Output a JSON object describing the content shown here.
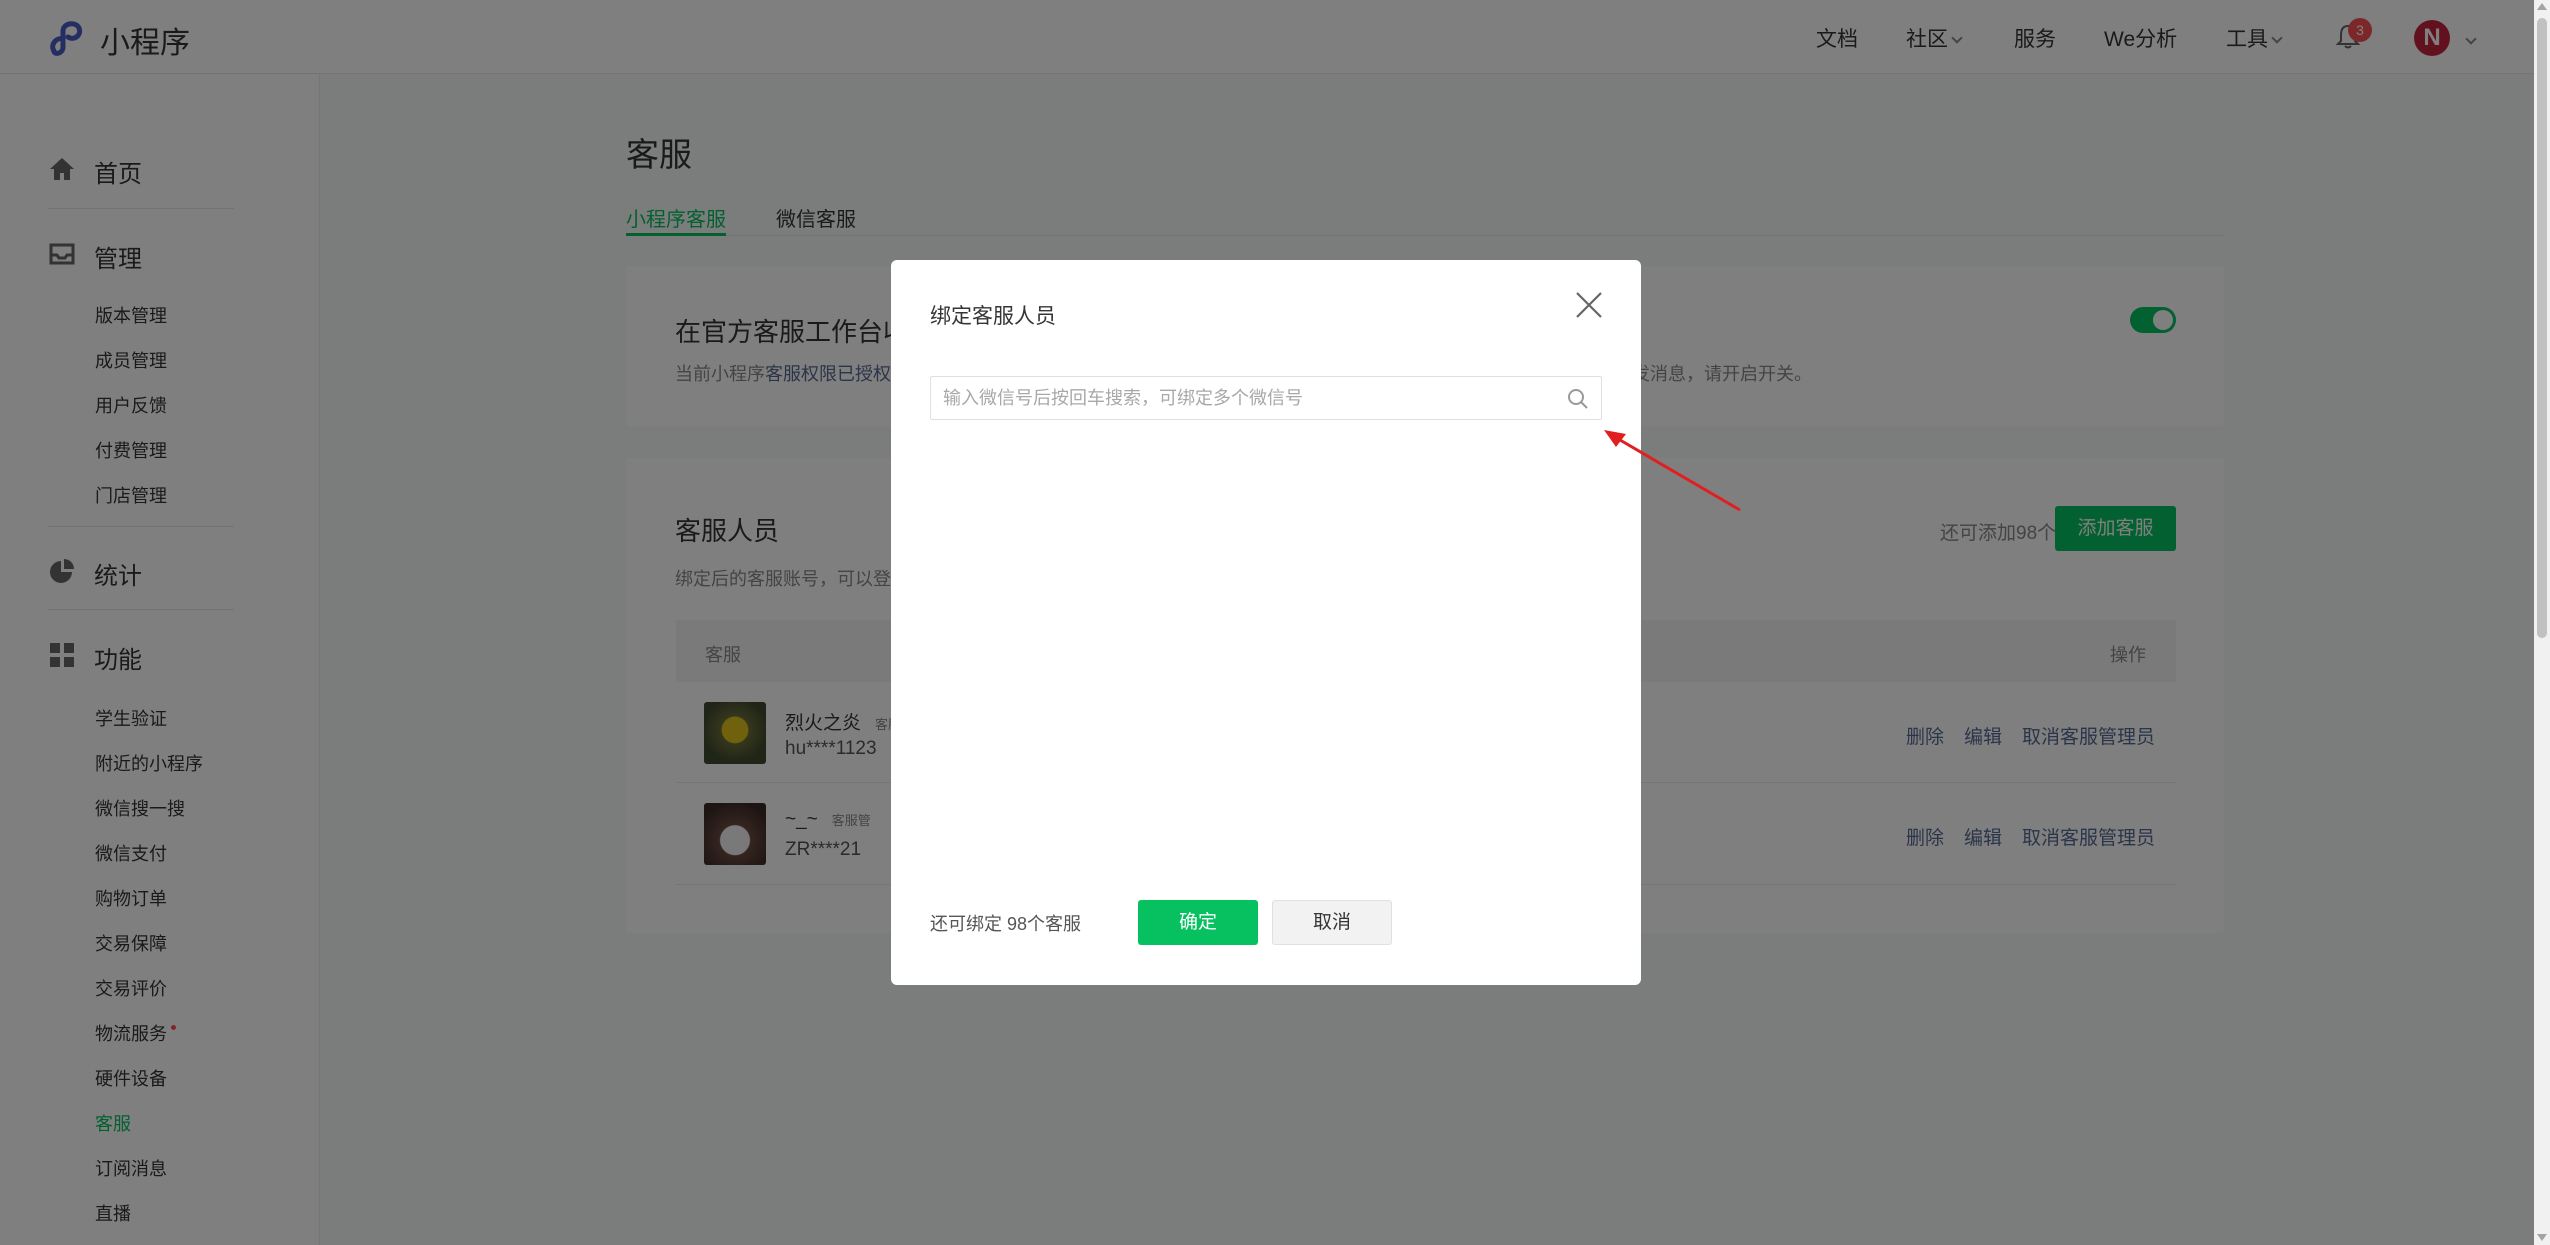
{
  "app": {
    "logo_text": "小程序"
  },
  "topnav": {
    "docs": "文档",
    "community": "社区",
    "services": "服务",
    "we_analysis": "We分析",
    "tools": "工具",
    "notification_count": "3",
    "avatar_letter": "N"
  },
  "sidebar": {
    "home": "首页",
    "manage": "管理",
    "manage_items": [
      "版本管理",
      "成员管理",
      "用户反馈",
      "付费管理",
      "门店管理"
    ],
    "stats": "统计",
    "features": "功能",
    "feature_items": [
      "学生验证",
      "附近的小程序",
      "微信搜一搜",
      "微信支付",
      "购物订单",
      "交易保障",
      "交易评价",
      "物流服务",
      "硬件设备",
      "客服",
      "订阅消息",
      "直播"
    ],
    "active_item": "客服"
  },
  "main": {
    "title": "客服",
    "tabs": [
      "小程序客服",
      "微信客服"
    ],
    "active_tab": "小程序客服",
    "card1": {
      "title": "在官方客服工作台收",
      "desc_prefix": "当前小程序",
      "desc_link": "客服权限已授权",
      "desc_suffix": "发消息，请开启开关。",
      "toggle_on": true
    },
    "card2": {
      "title": "客服人员",
      "desc": "绑定后的客服账号，可以登",
      "remain": "还可添加98个",
      "add_button": "添加客服",
      "col_agent": "客服",
      "col_action": "操作",
      "rows": [
        {
          "name": "烈火之炎",
          "role": "客服",
          "account": "hu****1123"
        },
        {
          "name": "~_~",
          "role": "客服管",
          "account": "ZR****21"
        }
      ],
      "actions": {
        "delete": "删除",
        "edit": "编辑",
        "revoke_admin": "取消客服管理员"
      }
    }
  },
  "modal": {
    "title": "绑定客服人员",
    "search_placeholder": "输入微信号后按回车搜索，可绑定多个微信号",
    "search_value": "",
    "remain_text": "还可绑定 98个客服",
    "confirm": "确定",
    "cancel": "取消"
  },
  "colors": {
    "brand_green": "#07c160",
    "link": "#576b95",
    "badge_red": "#fa5151",
    "arrow_red": "#e02020"
  }
}
